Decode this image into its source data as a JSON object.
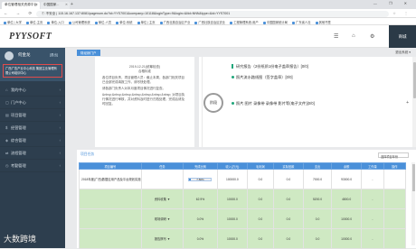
{
  "browser": {
    "tabs": [
      {
        "label": "单位管理相关资源平台"
      },
      {
        "label": "中国国家..."
      }
    ],
    "new_tab": "+",
    "window_controls": "— ❐ ✕",
    "url": "① 不安全 | 115.16.167.137:8081/pagenum.do?id=YYS7001&company=10118&loginType=9&login=&liid=NNN&type=&id=YYS7001",
    "bookmarks": [
      {
        "label": "单位 | 大学"
      },
      {
        "label": "单位-主页"
      },
      {
        "label": "单位-入口"
      },
      {
        "label": "公司管理系统"
      },
      {
        "label": "单位-人员"
      },
      {
        "label": "单位-系统"
      },
      {
        "label": "单位 | 主页"
      },
      {
        "label": "广西壮族自治区产业"
      },
      {
        "label": "广西壮族自治区农业"
      },
      {
        "label": "工程管理系统-用户"
      },
      {
        "label": "中国国家统计局"
      },
      {
        "label": "广东省人社"
      },
      {
        "label": "其他书签"
      }
    ]
  },
  "header": {
    "logo": "PYYSOFT",
    "user_label": "商城",
    "icons": [
      "message-icon",
      "shop-icon",
      "settings-icon"
    ]
  },
  "sidebar": {
    "username": "何金龙",
    "logout": "[退出]",
    "org": "广西广告产业中心科技 集团主业管理有限公司培训中心",
    "items": [
      {
        "label": "我的中心"
      },
      {
        "label": "门户中心"
      },
      {
        "label": "项目管理"
      },
      {
        "label": "经营管理"
      },
      {
        "label": "综合管理"
      },
      {
        "label": "流程管理"
      },
      {
        "label": "考勤管理"
      }
    ]
  },
  "content": {
    "tab_label": "财经销门户",
    "tab_dropdown": "退出系统 ▾",
    "doc": {
      "date": "2019-12-21(统筹检查)",
      "sub": "合格标准",
      "paragraphs": [
        "各位项目负责，项目管理人员：截止本周，各部门相关项目已全部完成填报工作，请尽快处理。",
        "请各部门负责人对本月度项目情况进行复查。",
        "&nbsp;&nbsp;&nbsp;&nbsp;&nbsp;&nbsp;&nbsp; 对项目执行情况进行审核，并对资料及时进行归档处理，完成后请及时回复。"
      ]
    },
    "timeline": {
      "center": "阶段",
      "items": [
        {
          "text": "研究报告（2份纸质1份电子盖章报告）[0/0]"
        },
        {
          "text": "照片流水路线图（签字盖章）[0/0]"
        },
        {
          "text": "照片 图片 录像带 录像带 影片等(电子文件)[0/0]"
        }
      ]
    },
    "project": {
      "title": "项目任务",
      "select": "选择项目年份",
      "columns": [
        "项目编号",
        "任务",
        "完成比例",
        "收入(万元)",
        "毛利润",
        "实际回款",
        "支出",
        "余额",
        "工作量",
        "操作"
      ],
      "rows": [
        {
          "name": "2018年度(广西)数据应用产品及平台规划实施",
          "task": "",
          "pct": 7.8,
          "pct_label": "7.80%",
          "income": "100000.0",
          "gross": "0.0",
          "received": "0.0",
          "spend": "7000.0",
          "balance": "93000.0",
          "work": "-"
        },
        {
          "name": "",
          "task": "资料收集 ▼",
          "pct": 62.9,
          "pct_label": "62.9%",
          "income": "10000.0",
          "gross": "0.0",
          "received": "0.0",
          "spend": "5200.0",
          "balance": "4800.0",
          "work": "-"
        },
        {
          "name": "",
          "task": "现场调研 ▼",
          "pct": 0.0,
          "pct_label": "0.0%",
          "income": "10000.0",
          "gross": "0.0",
          "received": "0.0",
          "spend": "0.0",
          "balance": "10000.0",
          "work": "-"
        },
        {
          "name": "",
          "task": "报告撰写 ▼",
          "pct": 0.0,
          "pct_label": "0.0%",
          "income": "10000.0",
          "gross": "0.0",
          "received": "0.0",
          "spend": "0.0",
          "balance": "10000.0",
          "work": "-"
        }
      ]
    }
  },
  "watermark": "大数跨境",
  "colors": {
    "accent": "#4a90d9",
    "sidebar": "#2d3e4e",
    "green": "#1fa67a",
    "row_highlight": "#cfe9c3"
  }
}
